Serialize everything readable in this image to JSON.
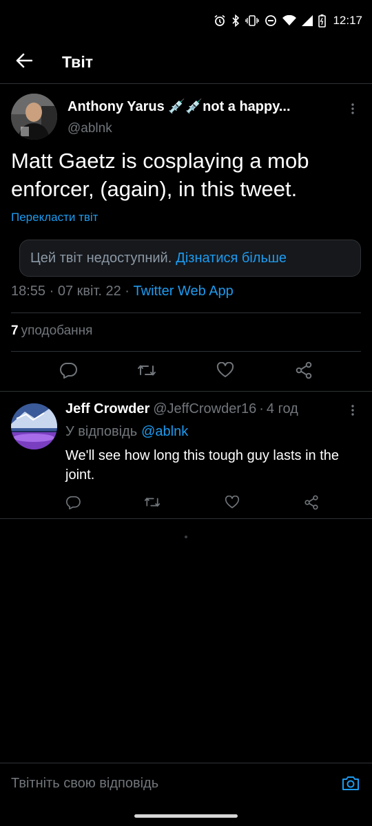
{
  "status_bar": {
    "time": "12:17",
    "icons": [
      "alarm-icon",
      "bluetooth-icon",
      "vibrate-icon",
      "do-not-disturb-icon",
      "wifi-icon",
      "signal-icon",
      "battery-icon"
    ]
  },
  "header": {
    "title": "Твіт",
    "back_icon": "arrow-left-icon"
  },
  "main_tweet": {
    "author_name": "Anthony Yarus 💉💉not a happy...",
    "author_handle": "@ablnk",
    "text": "Matt Gaetz is cosplaying a mob enforcer, (again), in this tweet.",
    "translate_label": "Перекласти твіт",
    "unavailable_text": "Цей твіт недоступний.",
    "learn_more_label": "Дізнатися більше",
    "timestamp": "18:55 · 07 квіт. 22 ·",
    "source_app": "Twitter Web App",
    "likes_count": "7",
    "likes_label": "уподобання"
  },
  "reply": {
    "author_name": "Jeff Crowder",
    "author_handle": "@JeffCrowder16",
    "separator": "·",
    "time_ago": "4 год",
    "replying_to_label": "У відповідь",
    "replying_to_handle": "@ablnk",
    "text": "We'll see how long this tough guy lasts in the joint."
  },
  "compose": {
    "placeholder": "Твітніть свою відповідь"
  },
  "colors": {
    "background": "#000000",
    "accent": "#1d9bf0",
    "secondary_text": "#71767b",
    "divider": "#2f3336"
  }
}
